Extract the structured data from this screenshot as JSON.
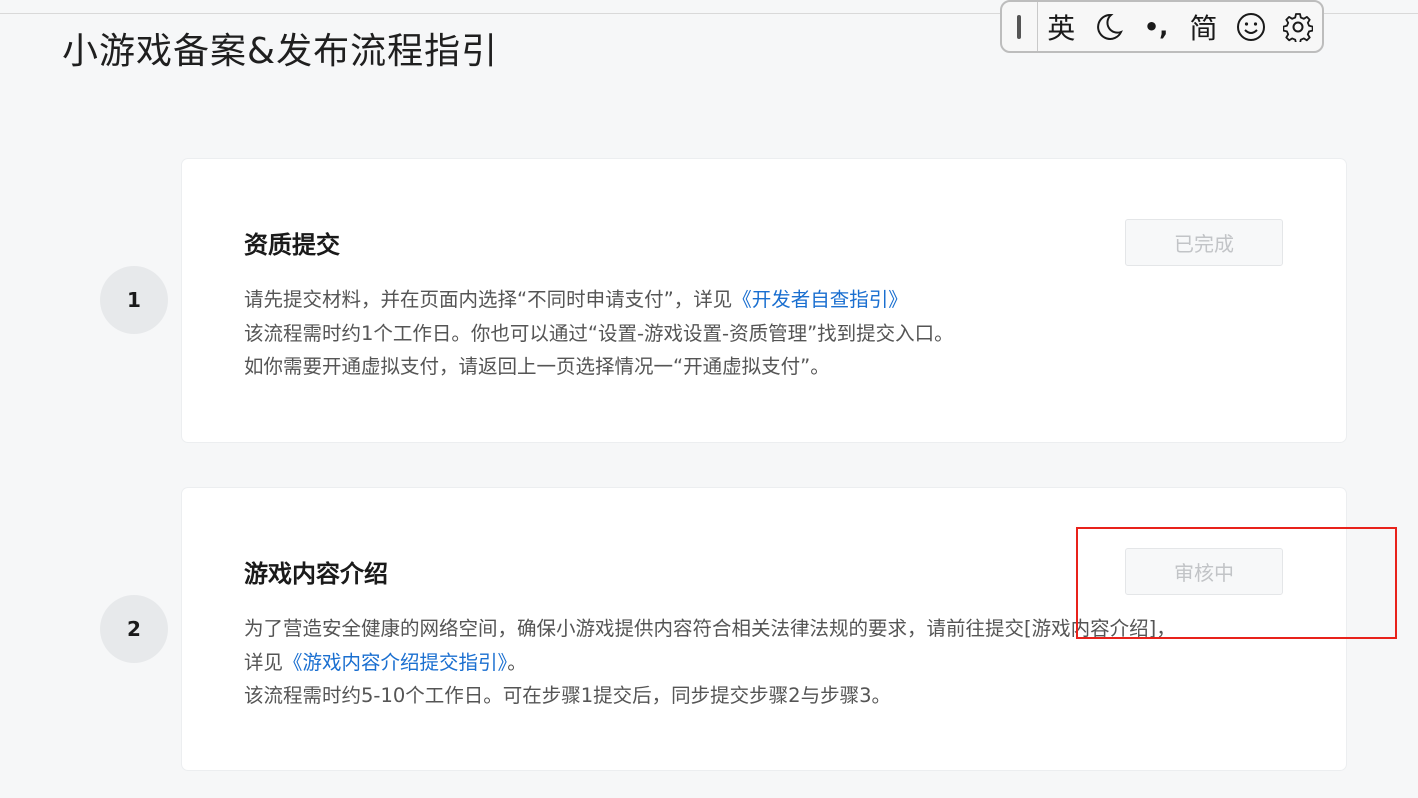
{
  "page": {
    "title": "小游戏备案&发布流程指引"
  },
  "ime_toolbar": {
    "items": [
      {
        "label": "英",
        "icon": ""
      },
      {
        "label": "",
        "icon": "moon-icon"
      },
      {
        "label": "•,",
        "icon": ""
      },
      {
        "label": "简",
        "icon": ""
      },
      {
        "label": "",
        "icon": "smiley-icon"
      },
      {
        "label": "",
        "icon": "gear-icon"
      }
    ]
  },
  "steps": [
    {
      "number": "1",
      "title": "资质提交",
      "status": "已完成",
      "line1_text": "请先提交材料，并在页面内选择“不同时申请支付”，详见",
      "line1_link": "《开发者自查指引》",
      "line2": "该流程需时约1个工作日。你也可以通过“设置-游戏设置-资质管理”找到提交入口。",
      "line3": "如你需要开通虚拟支付，请返回上一页选择情况一“开通虚拟支付”。"
    },
    {
      "number": "2",
      "title": "游戏内容介绍",
      "status": "审核中",
      "line1": "为了营造安全健康的网络空间，确保小游戏提供内容符合相关法律法规的要求，请前往提交[游戏内容介绍]，",
      "line2_text": "详见",
      "line2_link": "《游戏内容介绍提交指引》",
      "line2_tail": "。",
      "line3": "该流程需时约5-10个工作日。可在步骤1提交后，同步提交步骤2与步骤3。"
    }
  ],
  "colors": {
    "link": "#1a6fd0",
    "highlight": "#e8221b",
    "background": "#f6f7f8"
  }
}
